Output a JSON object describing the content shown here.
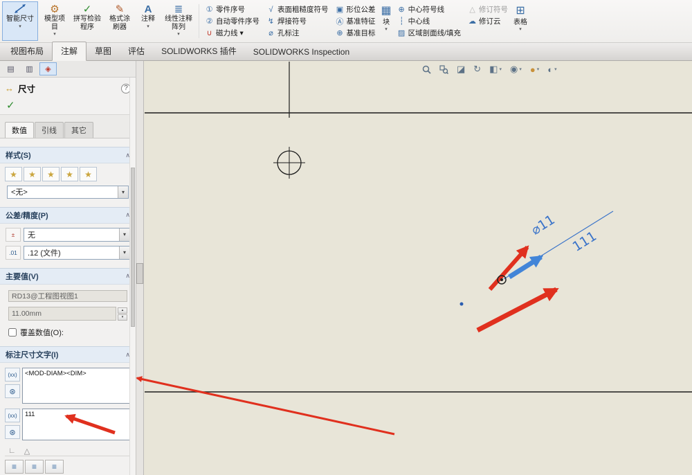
{
  "colors": {
    "canvas_bg": "#e8e5d8",
    "annotation_red": "#e0301e",
    "annotation_blue": "#4285d8",
    "dimension_blue": "#3b74c9",
    "line_black": "#1c1c1c"
  },
  "icons": {
    "dropdown": "▾",
    "collapse": "∧",
    "help": "?",
    "ok_check": "✓",
    "dimension": "↔",
    "model_items": "⚙",
    "spell_check": "✓",
    "format_painter": "✎",
    "note": "A",
    "linear_pattern": "≣",
    "balloon": "①",
    "auto_balloon": "②",
    "magnetic_line": "∪",
    "surface_finish": "√",
    "weld_symbol": "↯",
    "hole_callout": "⌀",
    "geometric_tolerance": "▣",
    "datum_feature": "Ⓐ",
    "datum_target": "⊕",
    "block": "▦",
    "center_mark": "⊕",
    "centerline": "┆",
    "area_hatch": "▨",
    "revision_symbol": "△",
    "revision_cloud": "☁",
    "table": "⊞",
    "panel_tab1": "▤",
    "panel_tab2": "▥",
    "panel_tab3": "◈",
    "style_star": "★",
    "tolerance_icon": "±",
    "precision_icon": ".01",
    "dim_text_icon": "(xx)",
    "symbol_library_icon": "⊛",
    "spin_up": "▴",
    "spin_down": "▾",
    "align_lines": "≡",
    "section_view": "◪",
    "rotate_view": "↻",
    "hide_show": "◉",
    "display_style": "◧",
    "appearance": "●",
    "view_settings": "◐",
    "corner_icon": "∟",
    "slant_icon": "△"
  },
  "ribbon": {
    "big": [
      "智能尺寸",
      "模型项目",
      "拼写检验程序",
      "格式涂刷器",
      "注释",
      "线性注释阵列"
    ],
    "cols": [
      [
        "零件序号",
        "自动零件序号",
        "磁力线"
      ],
      [
        "表面粗糙度符号",
        "焊接符号",
        "孔标注"
      ],
      [
        "形位公差",
        "基准特征",
        "基准目标"
      ],
      [
        "中心符号线",
        "中心线",
        "区域剖面线/填充"
      ],
      [
        "修订符号",
        "修订云"
      ]
    ],
    "block": "块",
    "table": "表格"
  },
  "tabs": [
    "视图布局",
    "注解",
    "草图",
    "评估",
    "SOLIDWORKS 插件",
    "SOLIDWORKS Inspection"
  ],
  "view_toolbar_icons": [
    "zoom-fit",
    "zoom-to-area",
    "section-view",
    "rotate-view",
    "display-style",
    "hide-show-items",
    "edit-appearance",
    "view-settings"
  ],
  "panel": {
    "title": "尺寸",
    "subtabs": [
      "数值",
      "引线",
      "其它"
    ],
    "sections": {
      "style": "样式(S)",
      "tolerance": "公差/精度(P)",
      "primary": "主要值(V)",
      "dim_text": "标注尺寸文字(I)"
    },
    "style_value": "<无>",
    "tolerance_value": "无",
    "precision_value": ".12 (文件)",
    "dim_name": "RD13@工程图视图1",
    "dim_value": "11.00mm",
    "override_label": "覆盖数值(O):",
    "dim_text_value": "<MOD-DIAM><DIM>",
    "dim_text_value2": "111"
  },
  "canvas": {
    "dimension_text": "⌀11",
    "dimension_override": "111"
  }
}
